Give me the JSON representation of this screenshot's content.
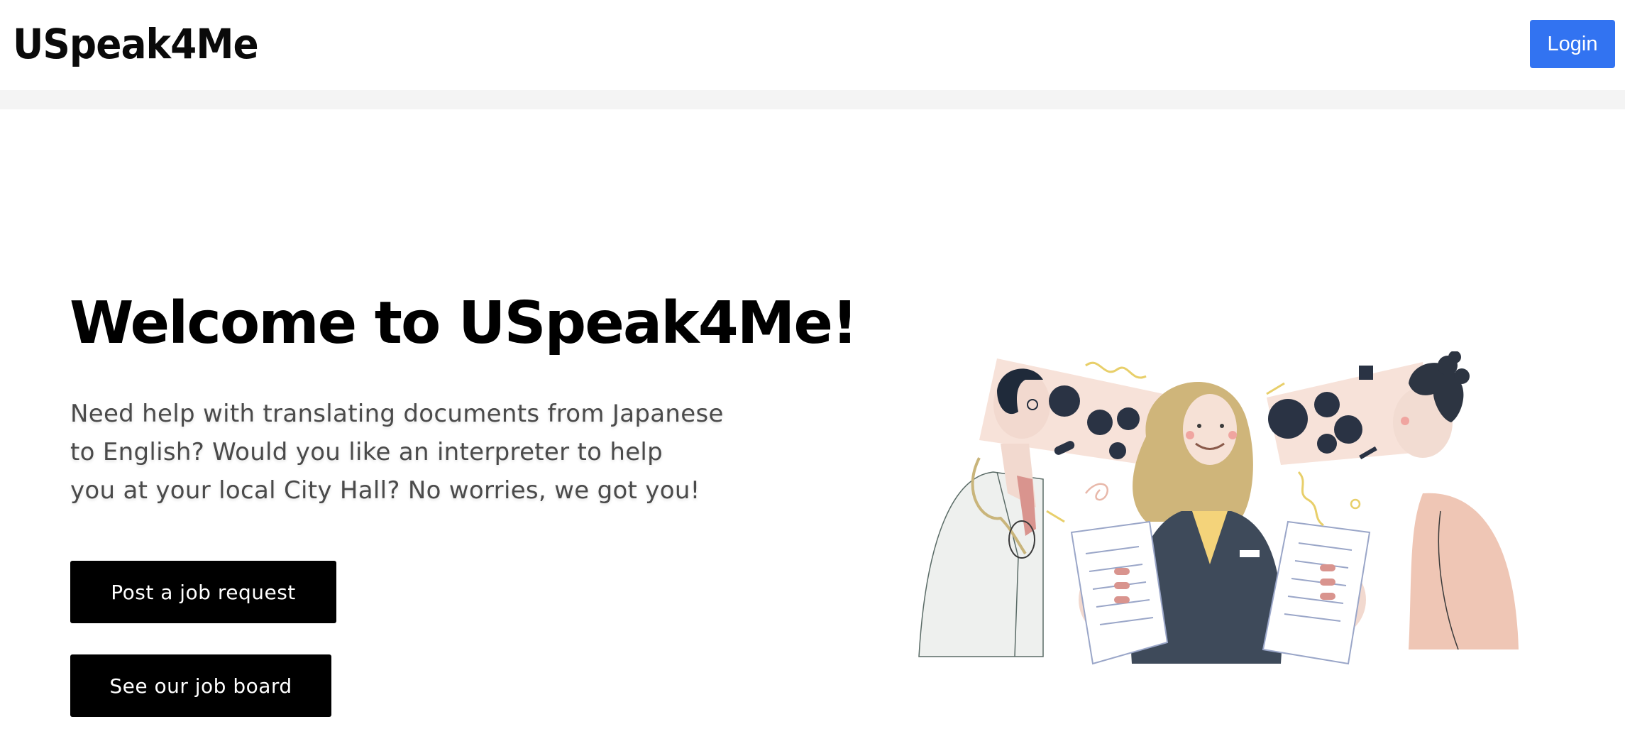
{
  "navbar": {
    "brand": "USpeak4Me",
    "login_label": "Login"
  },
  "hero": {
    "title": "Welcome to USpeak4Me!",
    "description_lines": [
      "Need help with translating documents from Japanese",
      "to English? Would you like an interpreter to help",
      "you at your local City Hall? No worries, we got you!"
    ],
    "post_job_label": "Post a job request",
    "job_board_label": "See our job board"
  },
  "illustration": {
    "icon": "translators-illustration-icon"
  },
  "colors": {
    "login_button": "#3273f1",
    "cta_button": "#000000",
    "divider_band": "#f4f4f4",
    "body_text": "#4a4a4a"
  }
}
